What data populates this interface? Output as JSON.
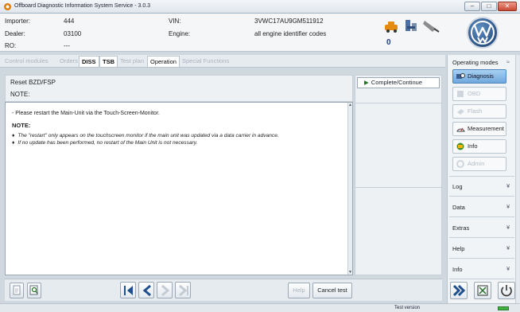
{
  "window": {
    "title": "Offboard Diagnostic Information System Service - 3.0.3"
  },
  "header": {
    "importer_label": "Importer:",
    "importer_value": "444",
    "dealer_label": "Dealer:",
    "dealer_value": "03100",
    "ro_label": "RO:",
    "ro_value": "---",
    "vin_label": "VIN:",
    "vin_value": "3VWC17AU9GM511912",
    "engine_label": "Engine:",
    "engine_value": "all engine identifier codes",
    "counter": "0"
  },
  "tabs": [
    {
      "label": "Control modules"
    },
    {
      "label": "Orders"
    },
    {
      "label": "DISS"
    },
    {
      "label": "TSB"
    },
    {
      "label": "Test plan"
    },
    {
      "label": "Operation"
    },
    {
      "label": "Special Functions"
    }
  ],
  "content": {
    "title": "Reset BZD/FSP",
    "note_label": "NOTE:",
    "line1": "- Please restart the Main-Unit via the Touch-Screen-Monitor.",
    "note_heading": "NOTE:",
    "bullets": [
      "The \"restart\" only appears on the touchscreen monitor if the main unit was updated via a data carrier in advance.",
      "If no update has been performed, no restart of the Main Unit is not necessary."
    ]
  },
  "actions": {
    "complete_label": "Complete/Continue"
  },
  "bottom": {
    "help_label": "Help",
    "cancel_label": "Cancel test"
  },
  "sidebar": {
    "operating_modes_label": "Operating modes",
    "modes": [
      {
        "label": "Diagnosis"
      },
      {
        "label": "OBD"
      },
      {
        "label": "Flash"
      },
      {
        "label": "Measurement"
      },
      {
        "label": "Info"
      },
      {
        "label": "Admin"
      }
    ],
    "sections": [
      {
        "label": "Log"
      },
      {
        "label": "Data"
      },
      {
        "label": "Extras"
      },
      {
        "label": "Help"
      },
      {
        "label": "Info"
      }
    ]
  },
  "status": {
    "text": "Test version"
  },
  "colors": {
    "selected_mode": "#6ea7dc",
    "complete_arrow": "#2a6e2a",
    "nav_arrows": "#1f4f8f",
    "close_button": "#c94a34"
  }
}
